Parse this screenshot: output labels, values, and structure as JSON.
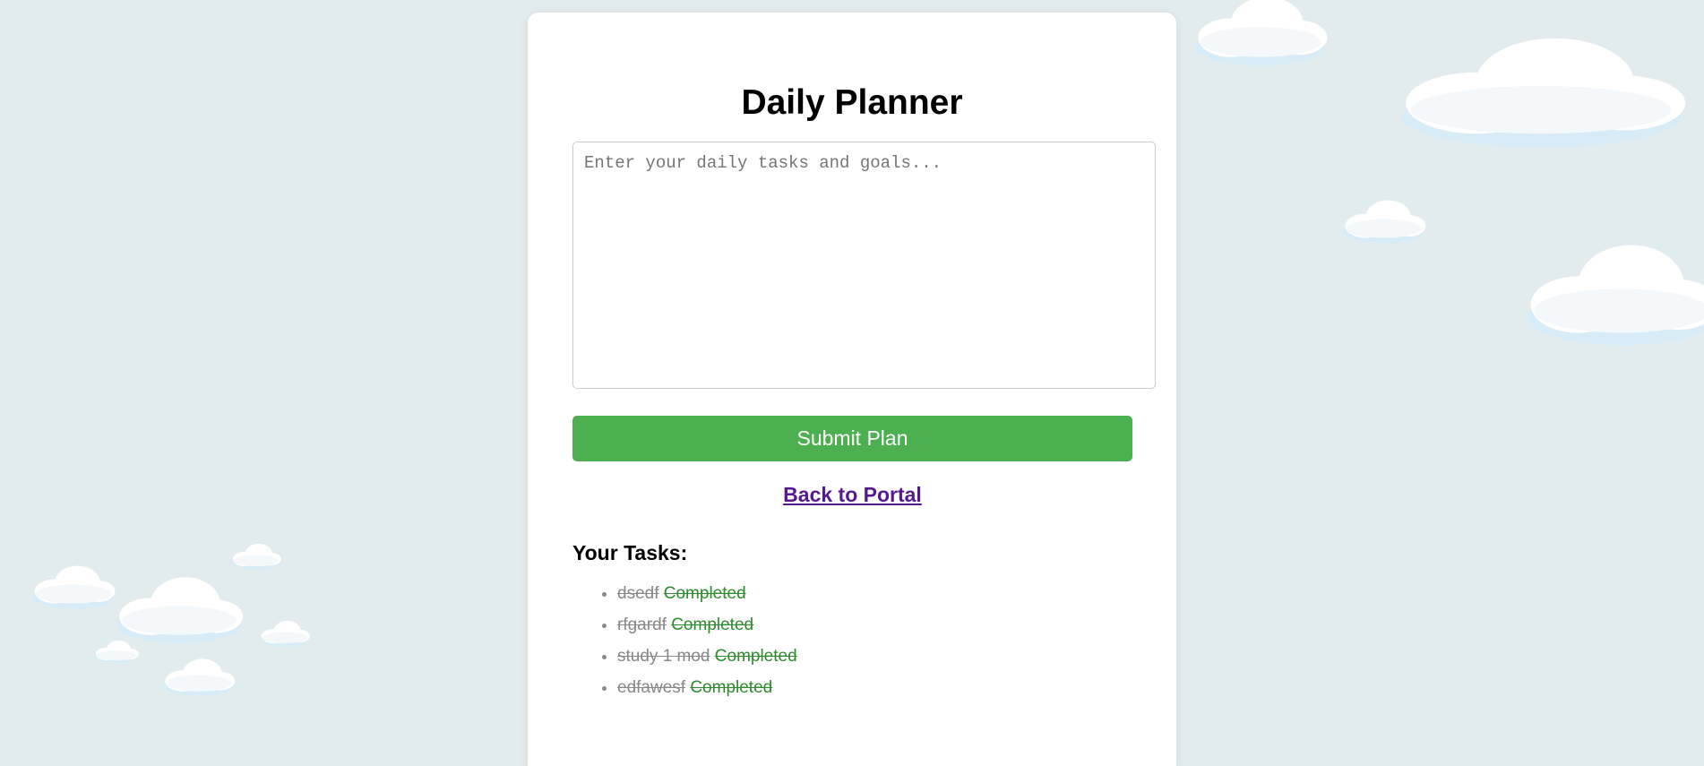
{
  "page": {
    "title": "Daily Planner"
  },
  "planner": {
    "placeholder": "Enter your daily tasks and goals...",
    "value": "",
    "submit_label": "Submit Plan",
    "back_link_label": "Back to Portal"
  },
  "tasks": {
    "heading": "Your Tasks:",
    "items": [
      {
        "text": "dsedf",
        "status": "Completed"
      },
      {
        "text": "rfgardf",
        "status": "Completed"
      },
      {
        "text": "study 1 mod",
        "status": "Completed"
      },
      {
        "text": "edfawesf",
        "status": "Completed"
      }
    ]
  },
  "colors": {
    "background": "#e2ebee",
    "card": "#ffffff",
    "accent": "#4caf50",
    "link": "#551a8b",
    "completed": "#2e8b2e",
    "task_text": "#888888"
  }
}
